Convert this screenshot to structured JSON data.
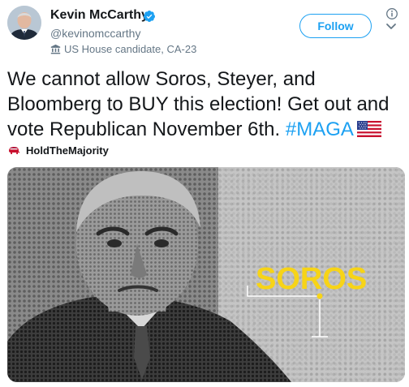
{
  "author": {
    "name": "Kevin McCarthy",
    "handle": "@kevinomccarthy",
    "label": "US House candidate, CA-23",
    "verified": true
  },
  "actions": {
    "follow_label": "Follow"
  },
  "tweet": {
    "text_before": "We cannot allow Soros, Steyer, and Bloomberg to BUY this election! Get out and vote Republican November 6th. ",
    "hashtag": "#MAGA",
    "emoji": "us-flag",
    "hashflag_label": "HoldTheMajority"
  },
  "media": {
    "overlay_text": "SOROS"
  },
  "colors": {
    "accent": "#1da1f2",
    "text": "#14171a",
    "muted": "#657786",
    "overlay_yellow": "#f7d417"
  }
}
